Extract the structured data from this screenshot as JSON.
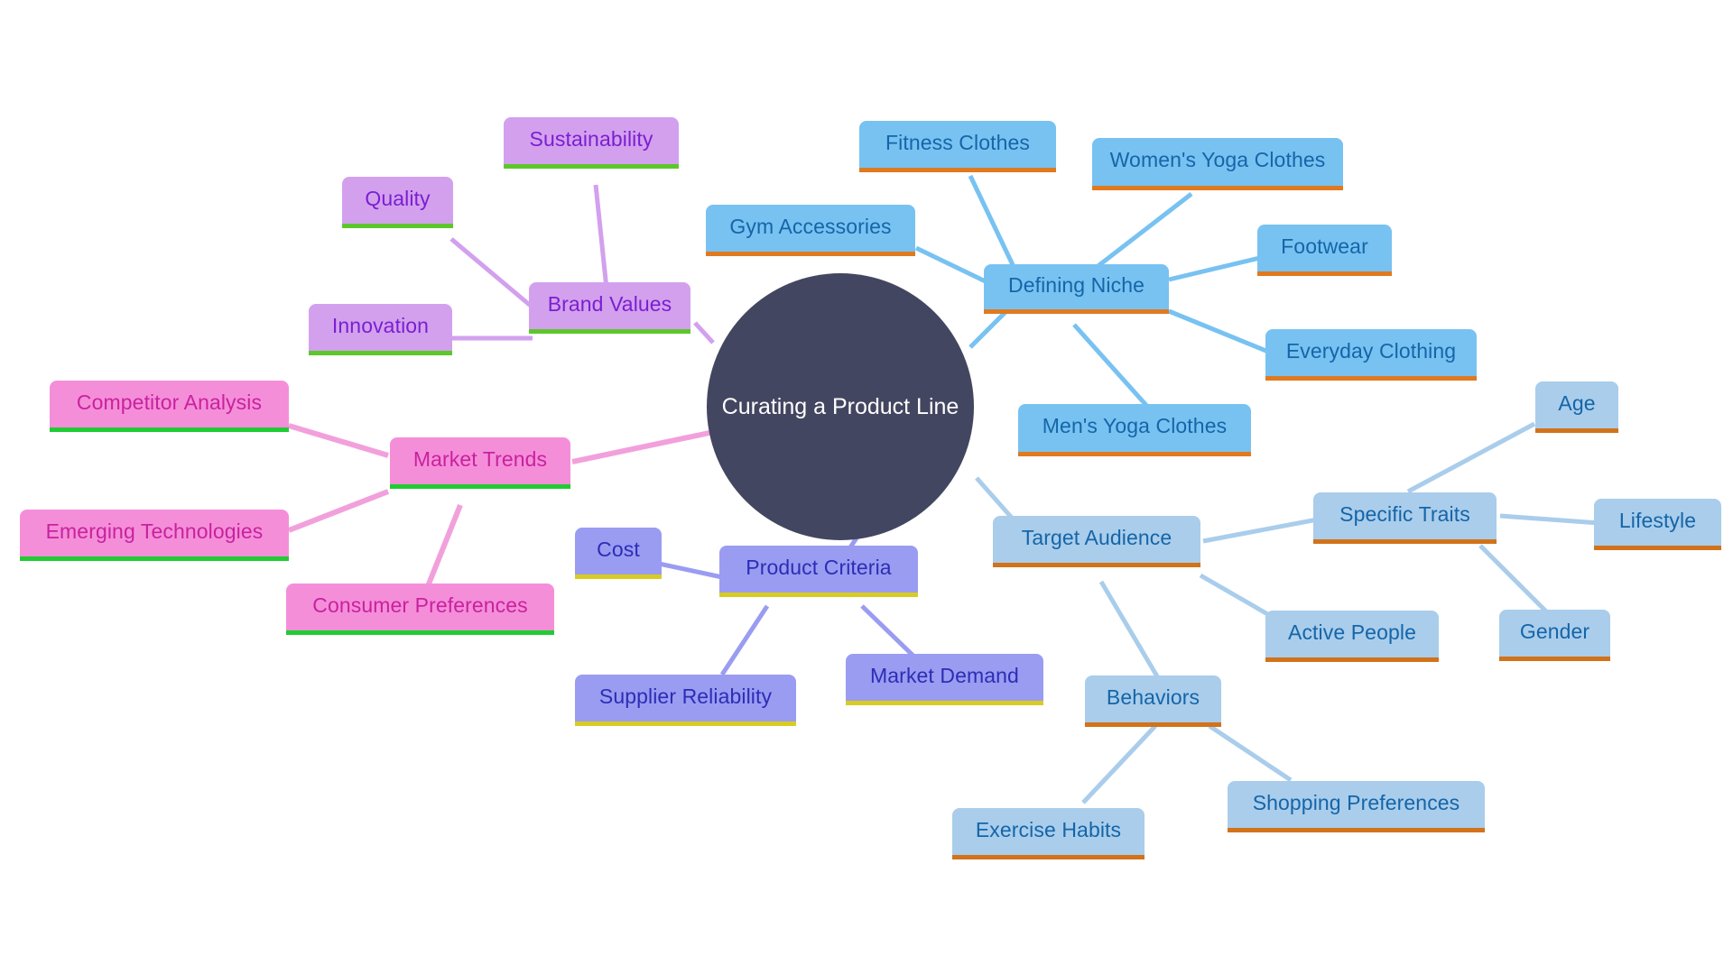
{
  "diagram": {
    "type": "mind-map",
    "title": "Curating a Product Line",
    "background": "#ffffff",
    "center": {
      "label": "Curating a Product Line",
      "fill": "#434660",
      "text_color": "#ffffff"
    },
    "palette": {
      "niche_fill": "#78c2f2",
      "niche_text": "#1565a8",
      "niche_underline": "#e07a1f",
      "target_fill": "#a9cdeb",
      "target_text": "#1565a8",
      "target_underline": "#d2721a",
      "criteria_fill": "#9a9cf2",
      "criteria_text": "#2d2db5",
      "criteria_underline": "#d8cc22",
      "brand_fill": "#d3a0ee",
      "brand_text": "#7b1fd0",
      "brand_underline": "#5dc72a",
      "trend_fill": "#f58ed9",
      "trend_text": "#c8229e",
      "trend_underline": "#20cc33"
    },
    "branches": [
      {
        "key": "defining_niche",
        "label": "Defining Niche",
        "children": [
          "Fitness Clothes",
          "Women's Yoga Clothes",
          "Gym Accessories",
          "Footwear",
          "Everyday Clothing",
          "Men's Yoga Clothes"
        ]
      },
      {
        "key": "target_audience",
        "label": "Target Audience",
        "children": [
          "Specific Traits",
          "Active People",
          "Behaviors"
        ],
        "grandchildren": {
          "Specific Traits": [
            "Age",
            "Lifestyle",
            "Gender"
          ],
          "Behaviors": [
            "Exercise Habits",
            "Shopping Preferences"
          ]
        }
      },
      {
        "key": "product_criteria",
        "label": "Product Criteria",
        "children": [
          "Cost",
          "Supplier Reliability",
          "Market Demand"
        ]
      },
      {
        "key": "brand_values",
        "label": "Brand Values",
        "children": [
          "Sustainability",
          "Quality",
          "Innovation"
        ]
      },
      {
        "key": "market_trends",
        "label": "Market Trends",
        "children": [
          "Competitor Analysis",
          "Emerging Technologies",
          "Consumer Preferences"
        ]
      }
    ]
  },
  "nodes": {
    "center": "Curating a Product Line",
    "defining_niche": "Defining Niche",
    "fitness_clothes": "Fitness Clothes",
    "womens_yoga_clothes": "Women's Yoga Clothes",
    "gym_accessories": "Gym Accessories",
    "footwear": "Footwear",
    "everyday_clothing": "Everyday Clothing",
    "mens_yoga_clothes": "Men's Yoga Clothes",
    "target_audience": "Target Audience",
    "specific_traits": "Specific Traits",
    "age": "Age",
    "lifestyle": "Lifestyle",
    "gender": "Gender",
    "active_people": "Active People",
    "behaviors": "Behaviors",
    "exercise_habits": "Exercise Habits",
    "shopping_preferences": "Shopping Preferences",
    "product_criteria": "Product Criteria",
    "cost": "Cost",
    "supplier_reliability": "Supplier Reliability",
    "market_demand": "Market Demand",
    "brand_values": "Brand Values",
    "sustainability": "Sustainability",
    "quality": "Quality",
    "innovation": "Innovation",
    "market_trends": "Market Trends",
    "competitor_analysis": "Competitor Analysis",
    "emerging_technologies": "Emerging Technologies",
    "consumer_preferences": "Consumer Preferences"
  }
}
